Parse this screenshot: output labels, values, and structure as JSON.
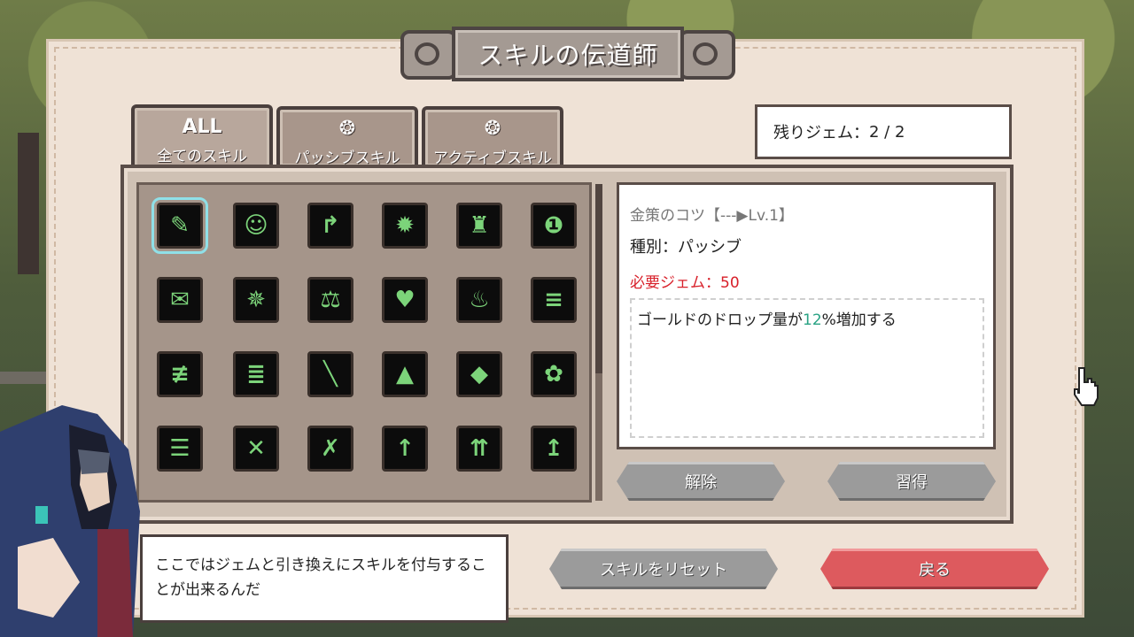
{
  "title": "スキルの伝道師",
  "tabs": [
    {
      "icon": "ALL",
      "label": "全てのスキル",
      "active": true
    },
    {
      "icon": "❂",
      "label": "パッシブスキル",
      "active": false
    },
    {
      "icon": "❂",
      "label": "アクティブスキル",
      "active": false
    }
  ],
  "gems": {
    "label": "残りジェム：",
    "value": "2 / 2"
  },
  "skills": {
    "glyphs": [
      [
        "✎",
        "☺",
        "↱",
        "✹",
        "♜",
        "❶"
      ],
      [
        "✉",
        "✵",
        "⚖",
        "♥",
        "♨",
        "≡"
      ],
      [
        "≢",
        "≣",
        "╲",
        "▲",
        "◆",
        "✿"
      ],
      [
        "☰",
        "✕",
        "✗",
        "↑",
        "⇈",
        "↥"
      ]
    ],
    "selected": [
      0,
      0
    ]
  },
  "detail": {
    "name": "金策のコツ【---▶Lv.1】",
    "type": "種別：パッシブ",
    "gem_cost": "必要ジェム：50",
    "desc_pre": "ゴールドのドロップ量が",
    "desc_pct": "12",
    "desc_post": "%増加する"
  },
  "buttons": {
    "release": "解除",
    "learn": "習得",
    "reset": "スキルをリセット",
    "back": "戻る"
  },
  "dialog": "ここではジェムと引き換えにスキルを付与することが出来るんだ",
  "colors": {
    "panel": "#efe2d6",
    "accent_red": "#dd5a5e",
    "skill_green": "#7cd47a",
    "highlight": "#2aa384"
  }
}
